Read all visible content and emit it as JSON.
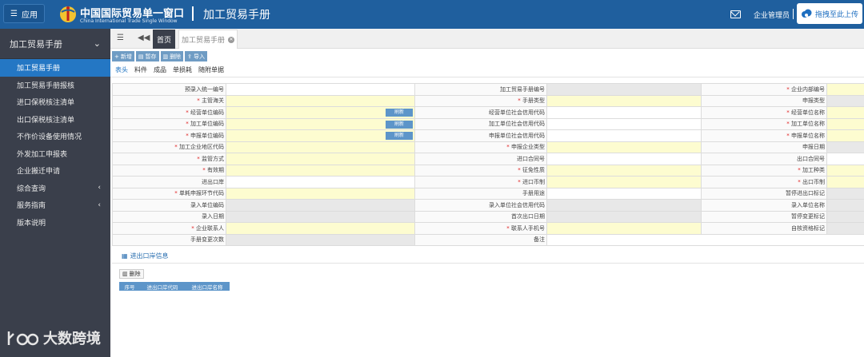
{
  "header": {
    "app_button": "应用",
    "brand_cn": "中国国际贸易单一窗口",
    "brand_en": "China International Trade Single Window",
    "module_title": "加工贸易手册",
    "admin_label": "企业管理员",
    "upload_label": "拖拽至此上传"
  },
  "sidebar": {
    "title": "加工贸易手册",
    "items": [
      {
        "label": "加工贸易手册",
        "active": true,
        "arrow": false
      },
      {
        "label": "加工贸易手册报核",
        "active": false,
        "arrow": false
      },
      {
        "label": "进口保税核注清单",
        "active": false,
        "arrow": false
      },
      {
        "label": "出口保税核注清单",
        "active": false,
        "arrow": false
      },
      {
        "label": "不作价设备使用情况",
        "active": false,
        "arrow": false
      },
      {
        "label": "外发加工申报表",
        "active": false,
        "arrow": false
      },
      {
        "label": "企业搬迁申请",
        "active": false,
        "arrow": false
      },
      {
        "label": "综合查询",
        "active": false,
        "arrow": true
      },
      {
        "label": "服务指南",
        "active": false,
        "arrow": true
      },
      {
        "label": "版本说明",
        "active": false,
        "arrow": false
      }
    ],
    "watermark": "大数跨境"
  },
  "tabs": {
    "home": "首页",
    "active": "加工贸易手册"
  },
  "toolbar": {
    "new": "新增",
    "save": "暂存",
    "delete": "删除",
    "import": "导入"
  },
  "subtabs": [
    "表头",
    "料件",
    "成品",
    "单损耗",
    "随附单据"
  ],
  "form": {
    "refresh": "刷新",
    "rows": [
      [
        {
          "l": "预录入统一编号",
          "r": false,
          "t": "v"
        },
        {
          "l": "加工贸易手册编号",
          "r": false,
          "t": "g"
        },
        {
          "l": "企业内部编号",
          "r": true,
          "t": "y"
        }
      ],
      [
        {
          "l": "主管海关",
          "r": true,
          "t": "y"
        },
        {
          "l": "手册类型",
          "r": true,
          "t": "y"
        },
        {
          "l": "申报类型",
          "r": false,
          "t": "g"
        }
      ],
      [
        {
          "l": "经营单位编码",
          "r": true,
          "t": "y",
          "btn": true
        },
        {
          "l": "经营单位社会信用代码",
          "r": false,
          "t": "v"
        },
        {
          "l": "经营单位名称",
          "r": true,
          "t": "y"
        }
      ],
      [
        {
          "l": "加工单位编码",
          "r": true,
          "t": "y",
          "btn": true
        },
        {
          "l": "加工单位社会信用代码",
          "r": false,
          "t": "v"
        },
        {
          "l": "加工单位名称",
          "r": true,
          "t": "y"
        }
      ],
      [
        {
          "l": "申报单位编码",
          "r": true,
          "t": "y",
          "btn": true
        },
        {
          "l": "申报单位社会信用代码",
          "r": false,
          "t": "v"
        },
        {
          "l": "申报单位名称",
          "r": true,
          "t": "y"
        }
      ],
      [
        {
          "l": "加工企业地区代码",
          "r": true,
          "t": "y"
        },
        {
          "l": "申报企业类型",
          "r": true,
          "t": "y"
        },
        {
          "l": "申报日期",
          "r": false,
          "t": "g"
        }
      ],
      [
        {
          "l": "监管方式",
          "r": true,
          "t": "y"
        },
        {
          "l": "进口合同号",
          "r": false,
          "t": "v"
        },
        {
          "l": "出口合同号",
          "r": false,
          "t": "v"
        }
      ],
      [
        {
          "l": "有效期",
          "r": true,
          "t": "y"
        },
        {
          "l": "征免性质",
          "r": true,
          "t": "y"
        },
        {
          "l": "加工种类",
          "r": true,
          "t": "y"
        }
      ],
      [
        {
          "l": "进出口岸",
          "r": false,
          "t": "v"
        },
        {
          "l": "进口币制",
          "r": true,
          "t": "y"
        },
        {
          "l": "出口币制",
          "r": true,
          "t": "y"
        }
      ],
      [
        {
          "l": "单耗申报环节代码",
          "r": true,
          "t": "y"
        },
        {
          "l": "手册用途",
          "r": false,
          "t": "v"
        },
        {
          "l": "暂停进出口标记",
          "r": false,
          "t": "g"
        }
      ],
      [
        {
          "l": "录入单位编码",
          "r": false,
          "t": "g"
        },
        {
          "l": "录入单位社会信用代码",
          "r": false,
          "t": "g"
        },
        {
          "l": "录入单位名称",
          "r": false,
          "t": "g"
        }
      ],
      [
        {
          "l": "录入日期",
          "r": false,
          "t": "g"
        },
        {
          "l": "首次出口日期",
          "r": false,
          "t": "g"
        },
        {
          "l": "暂停变更标记",
          "r": false,
          "t": "g"
        }
      ],
      [
        {
          "l": "企业联系人",
          "r": true,
          "t": "y"
        },
        {
          "l": "联系人手机号",
          "r": true,
          "t": "y"
        },
        {
          "l": "自核资格标记",
          "r": false,
          "t": "g"
        }
      ],
      [
        {
          "l": "手册变更次数",
          "r": false,
          "t": "g"
        },
        {
          "l": "备注",
          "r": false,
          "t": "v",
          "wide": true
        }
      ]
    ]
  },
  "port_section": {
    "title": "进出口岸信息",
    "delete": "删除",
    "columns": [
      "序号",
      "进出口岸代码",
      "进出口岸名称"
    ]
  }
}
